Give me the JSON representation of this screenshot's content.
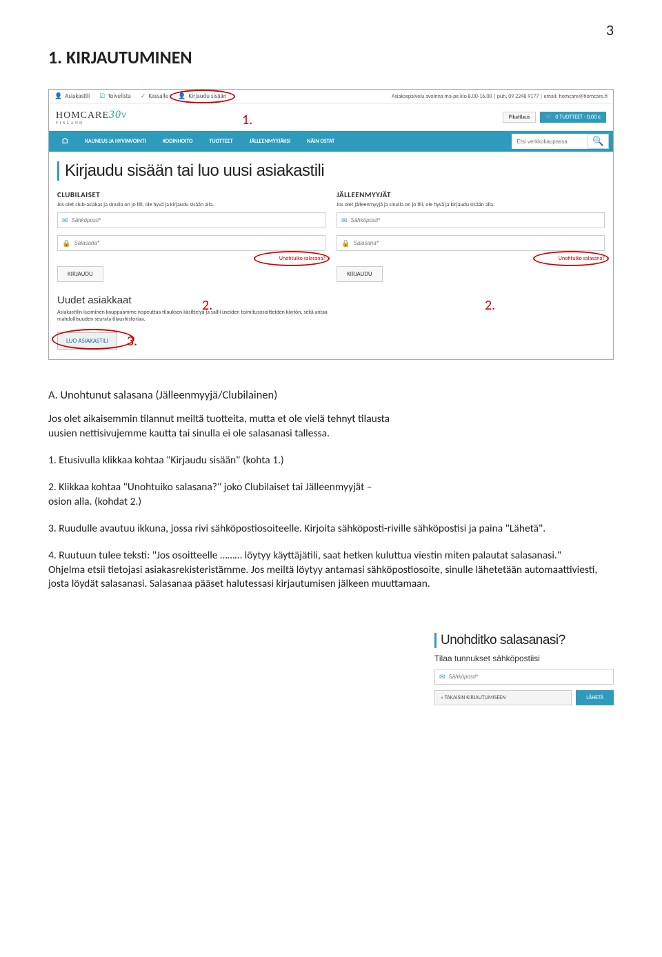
{
  "page_number": "3",
  "heading": "1. KIRJAUTUMINEN",
  "topbar": {
    "items": [
      "Asiakastili",
      "Toivelista",
      "Kassalle",
      "Kirjaudu sisään"
    ],
    "right": "Asiakaspalvelu avoinna ma-pe klo 8.00-16.00 | puh. 09 2248 9177 | email: homcare@homcare.fi"
  },
  "logo": {
    "brand": "HOMCARE",
    "version": "30v",
    "sub": "FINLAND"
  },
  "midbar": {
    "quick": "Pikatilaus",
    "cart": "0 TUOTTEET - 0,00 €"
  },
  "nav": {
    "items": [
      "KAUNEUS JA HYVINVOINTI",
      "KODINHOITO",
      "TUOTTEET",
      "JÄLLEENMYYJÄKSI",
      "NÄIN OSTAT"
    ],
    "search_placeholder": "Etsi verkkokaupassa"
  },
  "main_title": "Kirjaudu sisään tai luo uusi asiakastili",
  "left": {
    "title": "CLUBILAISET",
    "text": "Jos olet club-asiakas ja sinulla on jo tili, ole hyvä ja kirjaudu sisään alla.",
    "email": "Sähköposti*",
    "pass": "Salasana*",
    "forgot": "Unohtuiko salasana?",
    "btn": "KIRJAUDU"
  },
  "right": {
    "title": "JÄLLEENMYYJÄT",
    "text": "Jos olet jälleenmyyjä ja sinulla on jo tili, ole hyvä ja kirjaudu sisään alla.",
    "email": "Sähköposti*",
    "pass": "Salasana*",
    "forgot": "Unohtuiko salasana?",
    "btn": "KIRJAUDU"
  },
  "newcust": {
    "title": "Uudet asiakkaat",
    "text": "Asiakastilin luominen kauppaamme nopeuttaa tilauksen käsittelyä ja sallii useiden toimitusosoitteiden käytön, sekä antaa mahdollisuuden seurata tilaushistoriaa.",
    "btn": "LUO ASIAKASTILI"
  },
  "annotations": {
    "a1": "1.",
    "a2": "2.",
    "a2b": "2.",
    "a3": "3."
  },
  "section_a": {
    "title": "A. Unohtunut salasana (Jälleenmyyjä/Clubilainen)",
    "intro": "Jos olet aikaisemmin tilannut meiltä tuotteita, mutta et ole vielä tehnyt tilausta uusien nettisivujemme kautta tai sinulla ei ole salasanasi tallessa.",
    "step1": "1. Etusivulla klikkaa kohtaa \"Kirjaudu sisään\" (kohta 1.)",
    "step2": "2. Klikkaa kohtaa \"Unohtuiko salasana?\" joko Clubilaiset tai Jälleenmyyjät –osion alla. (kohdat 2.)",
    "step3": "3. Ruudulle avautuu ikkuna, jossa rivi sähköpostiosoiteelle. Kirjoita sähköposti-riville sähköpostisi ja paina \"Lähetä\".",
    "step4": "4. Ruutuun tulee teksti: \"Jos osoitteelle ……… löytyy käyttäjätili, saat hetken kuluttua viestin miten palautat salasanasi.\"",
    "step4b": "Ohjelma etsii tietojasi asiakasrekisteristämme. Jos meiltä löytyy antamasi sähköpostiosoite, sinulle lähetetään automaattiviesti, josta löydät salasanasi. Salasanaa pääset halutessasi kirjautumisen jälkeen muuttamaan."
  },
  "sidebox": {
    "title": "Unohditko salasanasi?",
    "sub": "Tilaa tunnukset sähköpostiisi",
    "email": "Sähköposti*",
    "back": "« TAKAISIN KIRJAUTUMISEEN",
    "send": "LÄHETÄ"
  }
}
